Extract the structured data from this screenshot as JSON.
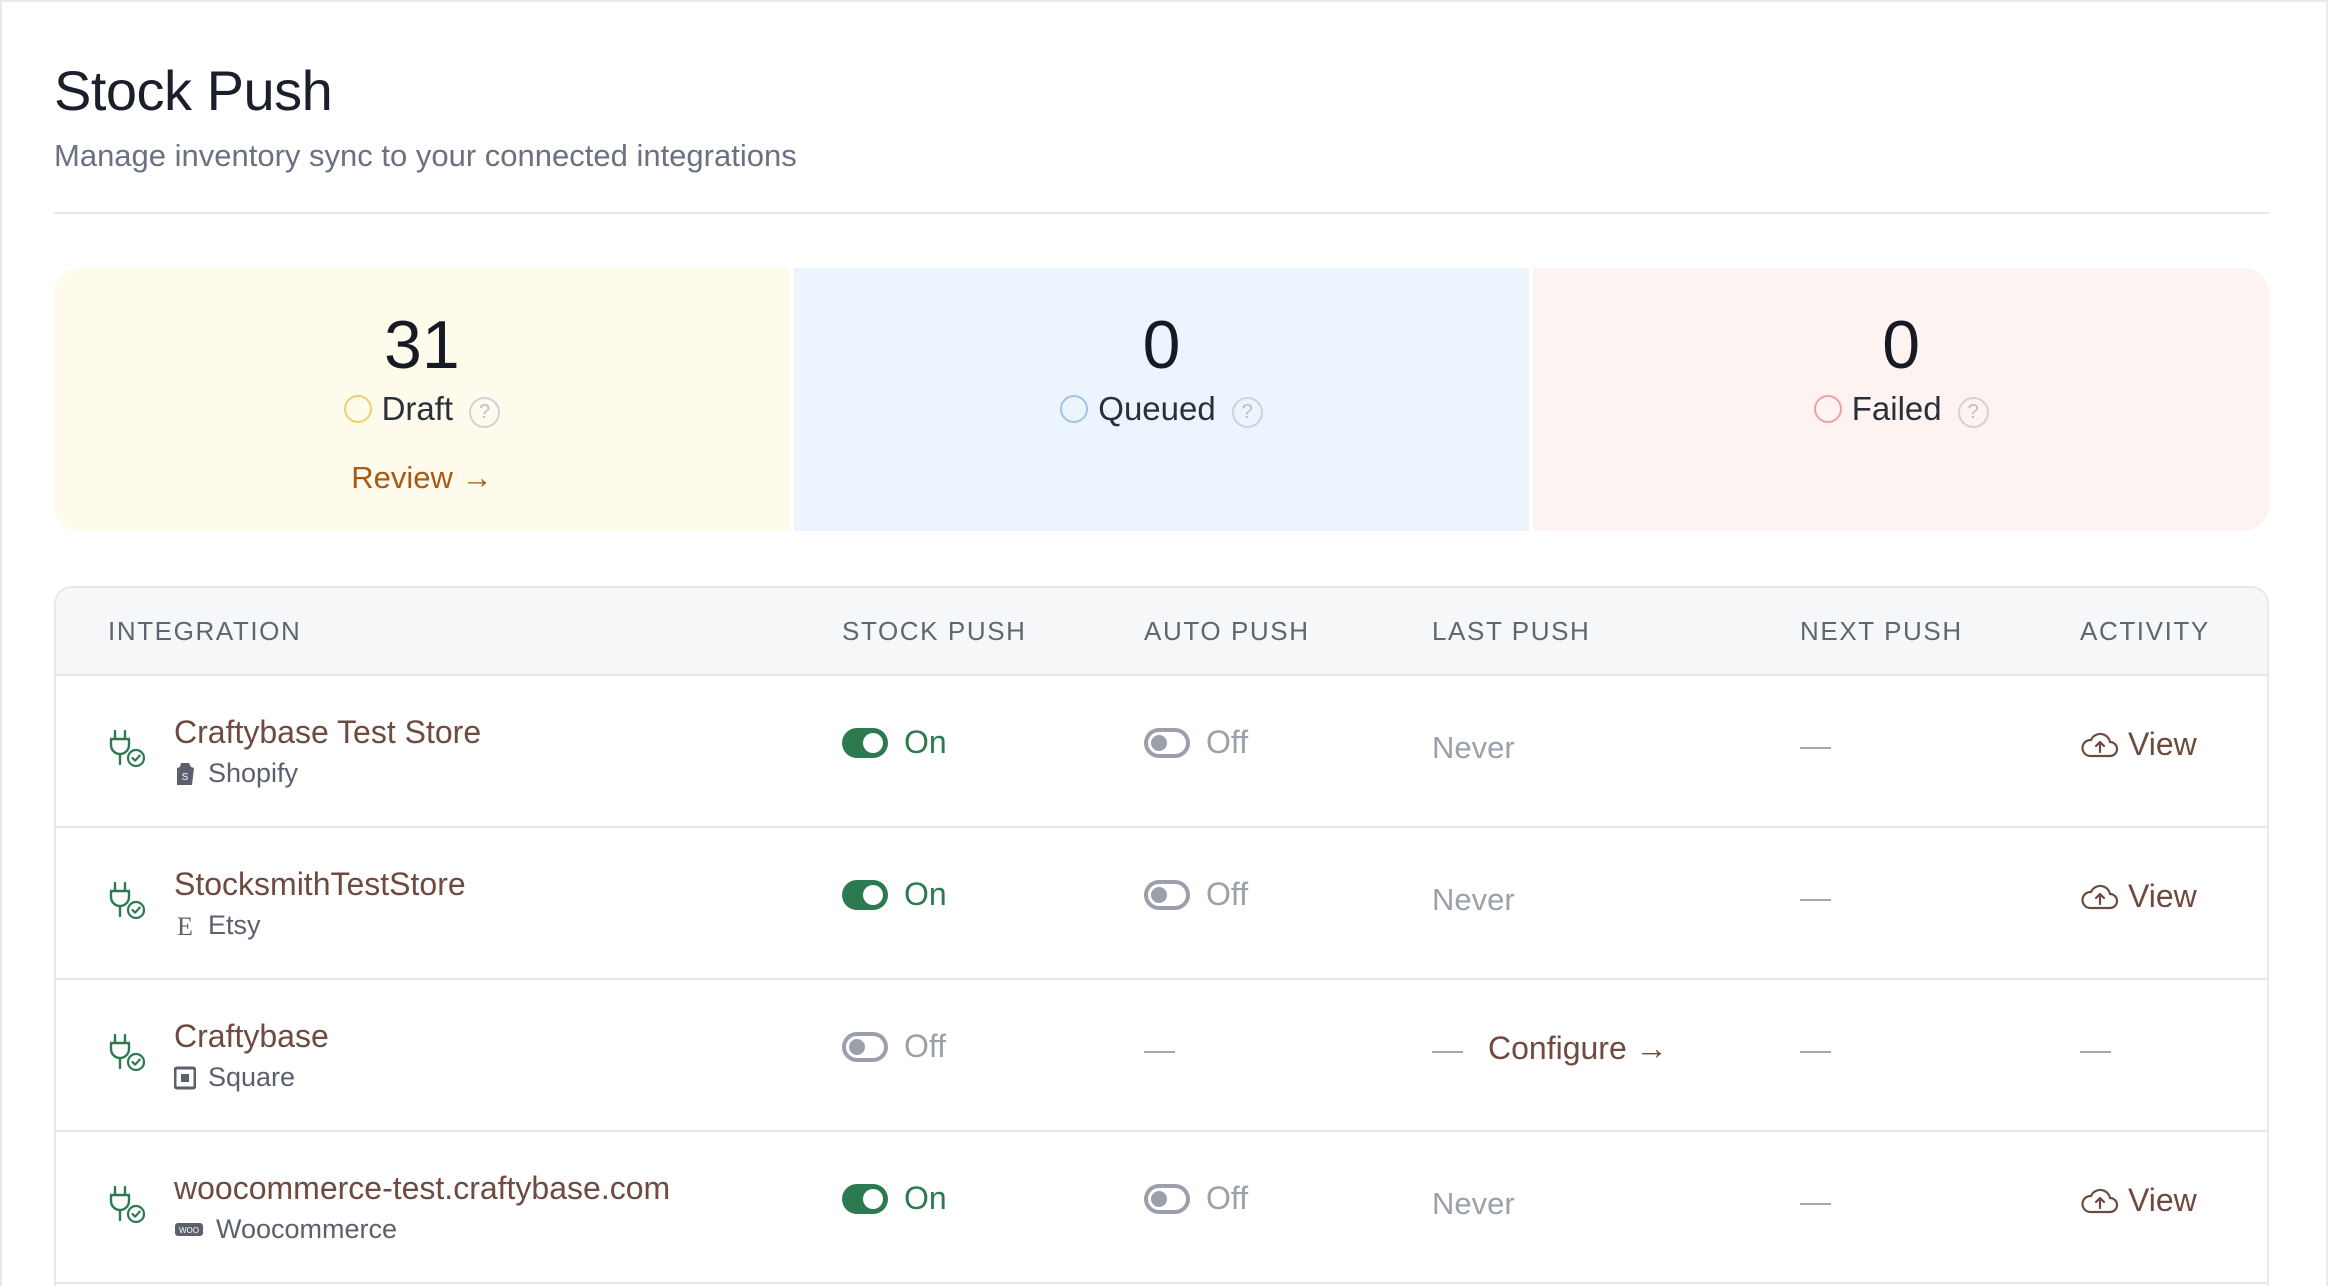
{
  "header": {
    "title": "Stock Push",
    "subtitle": "Manage inventory sync to your connected integrations"
  },
  "stats": [
    {
      "key": "draft",
      "value": "31",
      "label": "Draft",
      "help": "?",
      "link": "Review →",
      "color": "#f0cf6a"
    },
    {
      "key": "queued",
      "value": "0",
      "label": "Queued",
      "help": "?",
      "color": "#9cc4ec"
    },
    {
      "key": "failed",
      "value": "0",
      "label": "Failed",
      "help": "?",
      "color": "#eba2a2"
    }
  ],
  "table": {
    "columns": [
      "INTEGRATION",
      "STOCK PUSH",
      "AUTO PUSH",
      "LAST PUSH",
      "NEXT PUSH",
      "ACTIVITY"
    ],
    "rows": [
      {
        "name": "Craftybase Test Store",
        "type": "Shopify",
        "type_icon": "shopify-icon",
        "stock_push": "On",
        "auto_push": "Off",
        "last_push": "Never",
        "next_push": "—",
        "activity": "View"
      },
      {
        "name": "StocksmithTestStore",
        "type": "Etsy",
        "type_icon": "etsy-icon",
        "stock_push": "On",
        "auto_push": "Off",
        "last_push": "Never",
        "next_push": "—",
        "activity": "View"
      },
      {
        "name": "Craftybase",
        "type": "Square",
        "type_icon": "square-icon",
        "stock_push": "Off",
        "auto_push": "—",
        "last_push": "—",
        "last_push_link": "Configure →",
        "next_push": "—",
        "activity": "—"
      },
      {
        "name": "woocommerce-test.craftybase.com",
        "type": "Woocommerce",
        "type_icon": "woocommerce-icon",
        "stock_push": "On",
        "auto_push": "Off",
        "last_push": "Never",
        "next_push": "—",
        "activity": "View"
      }
    ]
  },
  "colors": {
    "on": "#2d7a50",
    "link": "#6e4a3f",
    "review": "#a85a12"
  }
}
